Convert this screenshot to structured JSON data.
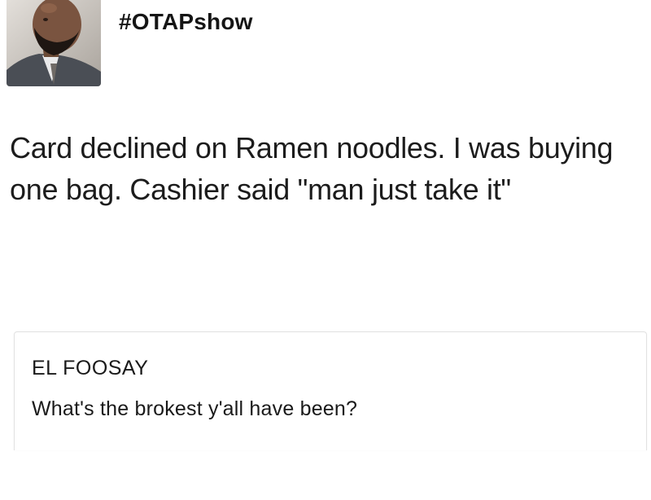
{
  "post": {
    "username": "#OTAPshow",
    "avatar_icon": "user-avatar-photo",
    "text": "Card declined on Ramen noodles. I was buying one bag. Cashier said \"man just take it\""
  },
  "quoted_post": {
    "author": "EL FOOSAY",
    "text": "What's the brokest y'all have been?"
  }
}
